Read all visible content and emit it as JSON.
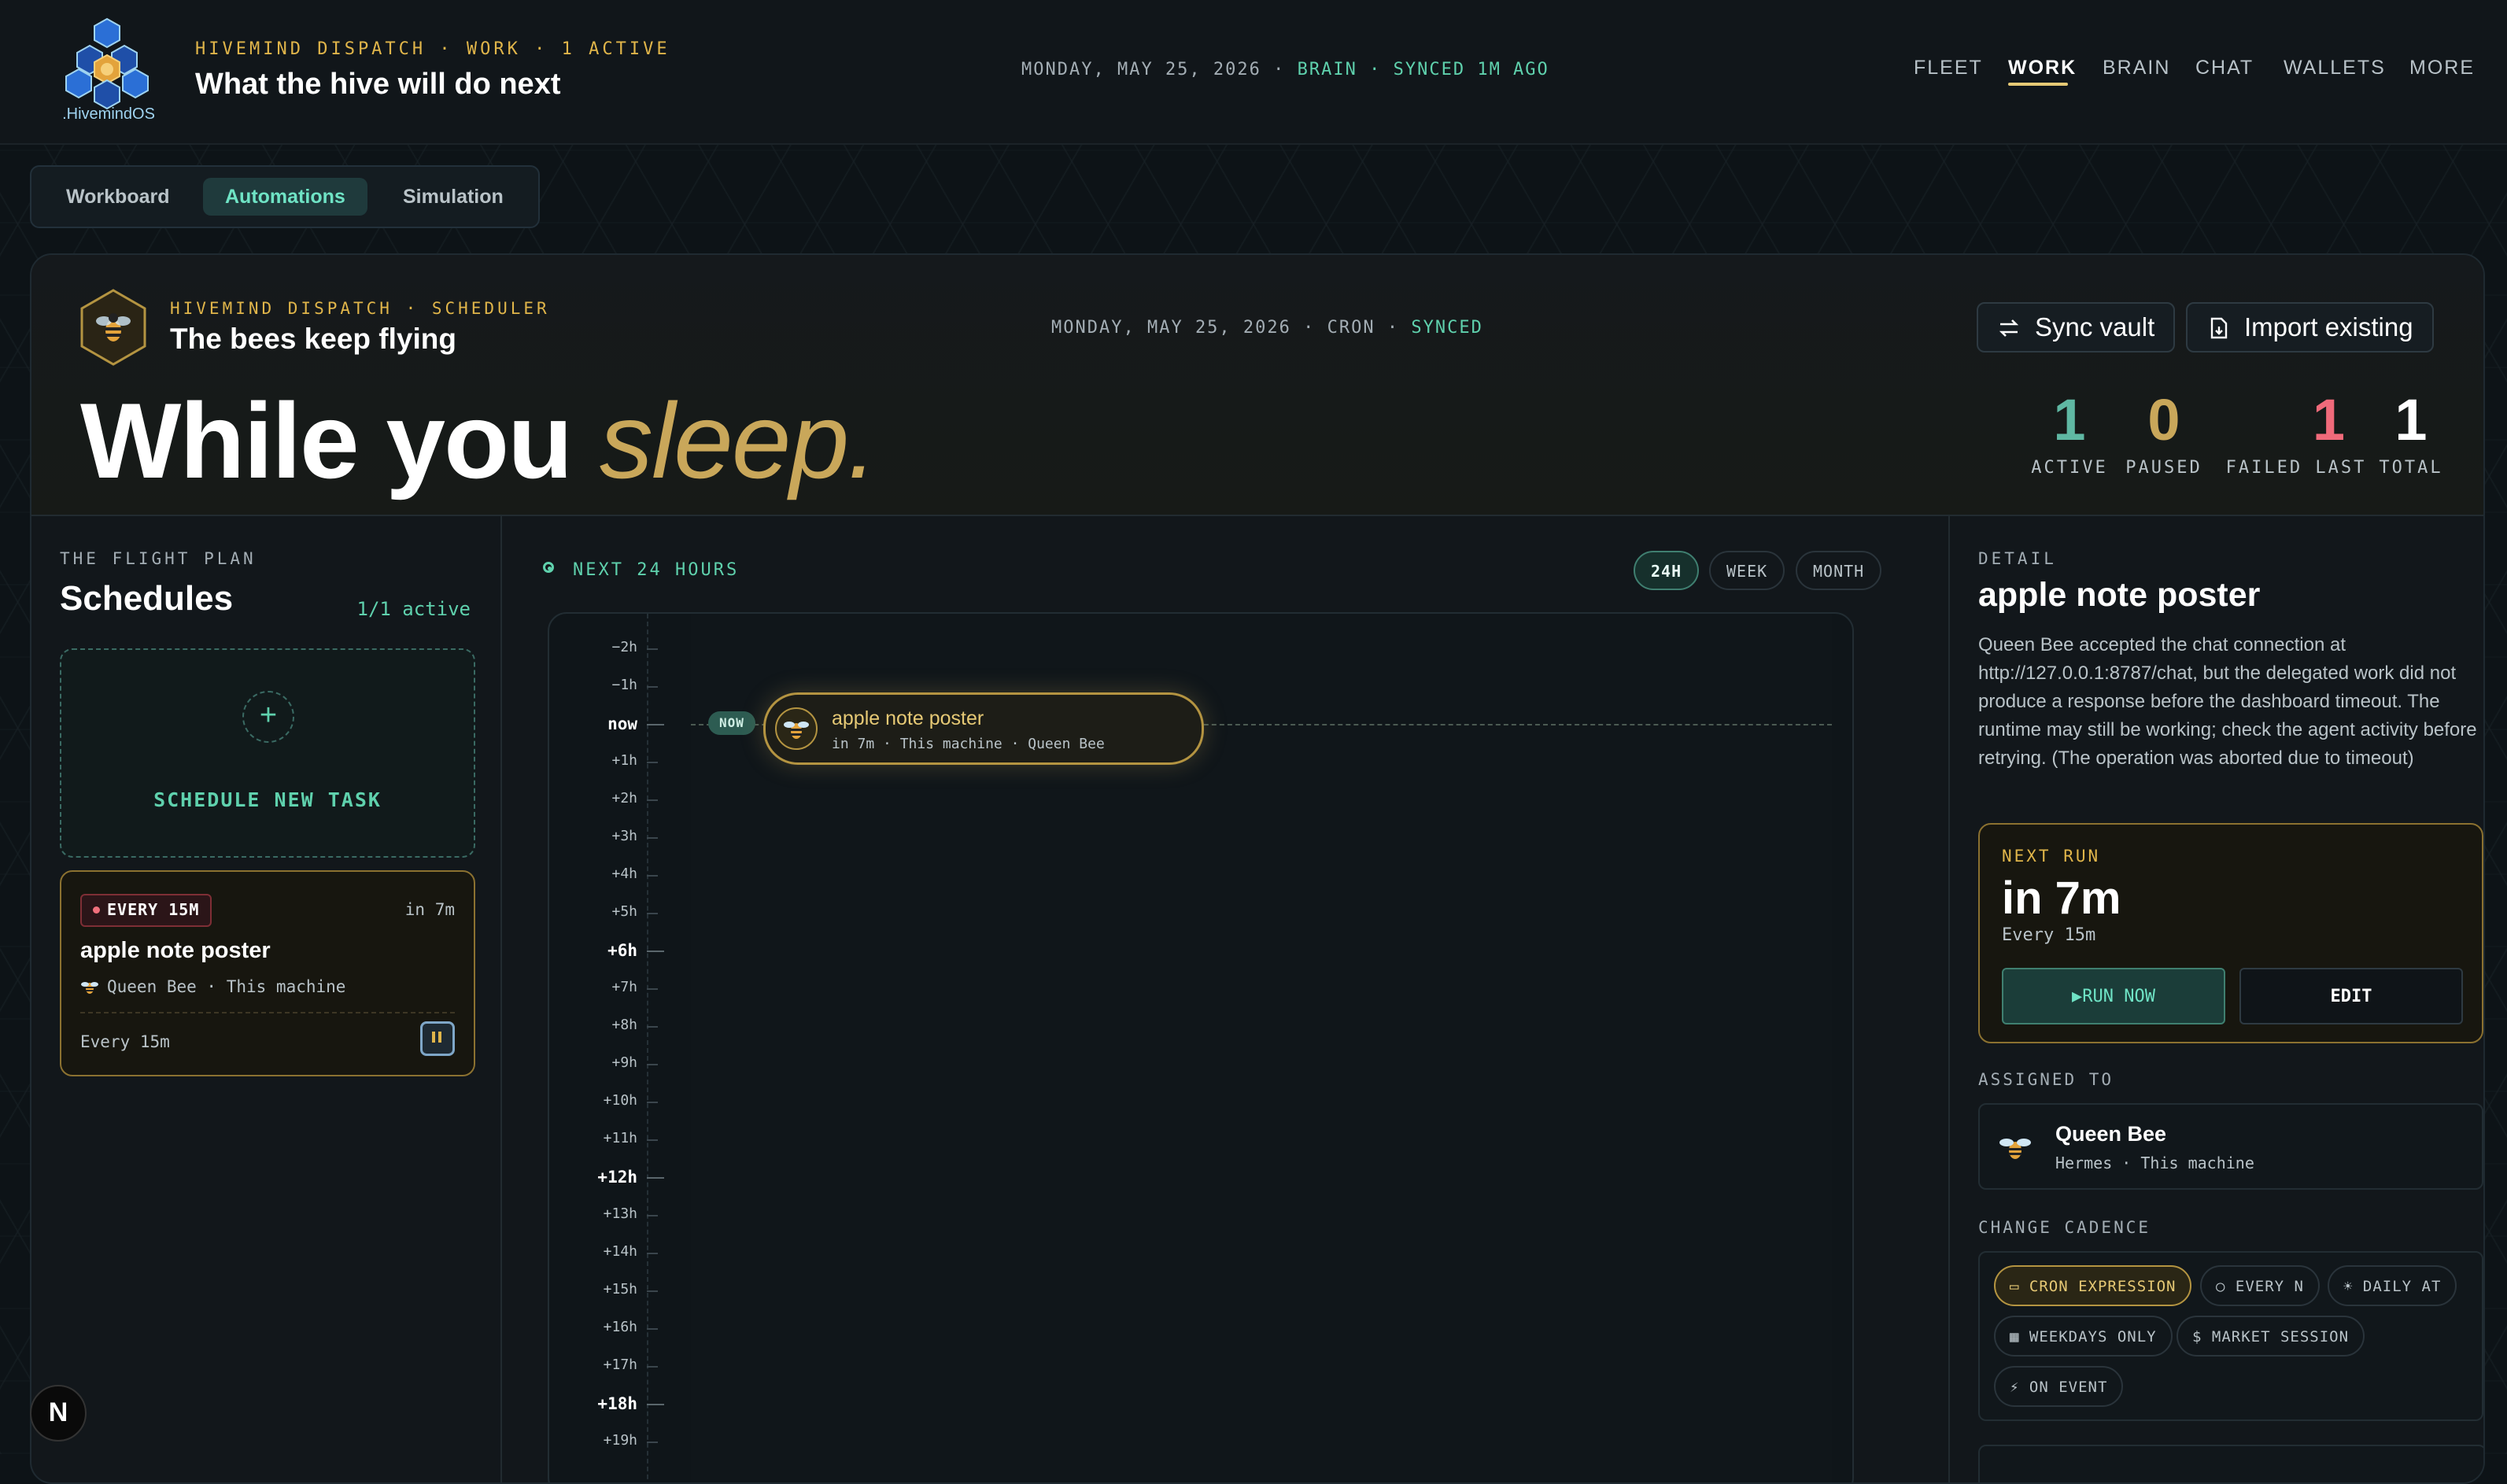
{
  "header": {
    "logo_text": ".HivemindOS",
    "eyebrow": "HIVEMIND DISPATCH · WORK · 1 ACTIVE",
    "title": "What the hive will do next",
    "status_date": "MONDAY, MAY 25, 2026 · ",
    "status_brain": "BRAIN · SYNCED 1M AGO",
    "nav": [
      "FLEET",
      "WORK",
      "BRAIN",
      "CHAT",
      "WALLETS",
      "MORE"
    ],
    "active_nav": "WORK"
  },
  "tabs": [
    "Workboard",
    "Automations",
    "Simulation"
  ],
  "active_tab": "Automations",
  "scheduler": {
    "eyebrow": "HIVEMIND DISPATCH · SCHEDULER",
    "title": "The bees keep flying",
    "status_prefix": "MONDAY, MAY 25, 2026 · CRON · ",
    "status_synced": "SYNCED",
    "sync_button": "Sync vault",
    "import_button": "Import existing",
    "hero_main": "While you ",
    "hero_accent": "sleep.",
    "stats": [
      {
        "value": "1",
        "label": "ACTIVE",
        "color": "#5fb8a3"
      },
      {
        "value": "0",
        "label": "PAUSED",
        "color": "#c9a75a"
      },
      {
        "value": "1",
        "label": "FAILED LAST",
        "color": "#f06a7a"
      },
      {
        "value": "1",
        "label": "TOTAL",
        "color": "#ffffff"
      }
    ]
  },
  "flight_plan": {
    "eyebrow": "THE FLIGHT PLAN",
    "title": "Schedules",
    "count": "1/1 active",
    "new_task_label": "SCHEDULE NEW TASK",
    "card": {
      "cadence": "EVERY 15M",
      "in": "in 7m",
      "title": "apple note poster",
      "meta": "Queen Bee · This machine",
      "every": "Every 15m"
    }
  },
  "timeline": {
    "heading": "NEXT 24 HOURS",
    "ranges": [
      "24H",
      "WEEK",
      "MONTH"
    ],
    "active_range": "24H",
    "ticks": [
      "−2h",
      "−1h",
      "now",
      "+1h",
      "+2h",
      "+3h",
      "+4h",
      "+5h",
      "+6h",
      "+7h",
      "+8h",
      "+9h",
      "+10h",
      "+11h",
      "+12h",
      "+13h",
      "+14h",
      "+15h",
      "+16h",
      "+17h",
      "+18h",
      "+19h"
    ],
    "major_ticks": [
      "now",
      "+6h",
      "+12h",
      "+18h"
    ],
    "now_pill": "NOW",
    "event": {
      "title": "apple note poster",
      "meta": "in 7m · This machine · Queen Bee"
    }
  },
  "detail": {
    "eyebrow": "DETAIL",
    "title": "apple note poster",
    "description": "Queen Bee accepted the chat connection at http://127.0.0.1:8787/chat, but the delegated work did not produce a response before the dashboard timeout. The runtime may still be working; check the agent activity before retrying. (The operation was aborted due to timeout)",
    "next_run_label": "NEXT RUN",
    "next_run_value": "in 7m",
    "next_run_sub": "Every 15m",
    "run_now": "▶RUN NOW",
    "edit": "EDIT",
    "assigned_label": "ASSIGNED TO",
    "assigned_name": "Queen Bee",
    "assigned_meta": "Hermes · This machine",
    "cadence_label": "CHANGE CADENCE",
    "cadence_options": [
      "▭ CRON EXPRESSION",
      "○ EVERY N",
      "☀ DAILY AT",
      "▦ WEEKDAYS ONLY",
      "$ MARKET SESSION",
      "⚡ ON EVENT"
    ],
    "active_cadence": "▭ CRON EXPRESSION"
  },
  "corner_badge": "N"
}
